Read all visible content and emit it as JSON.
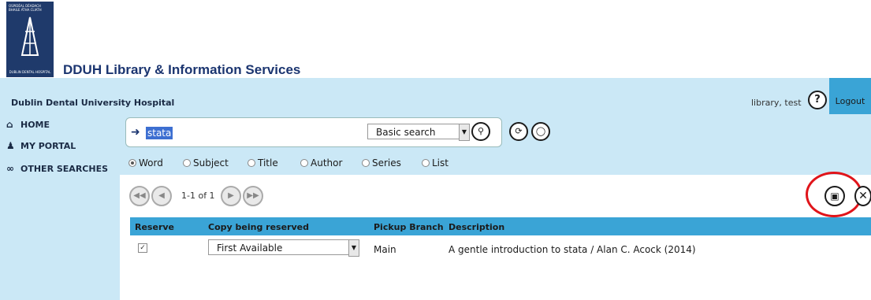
{
  "header": {
    "logo_top": "OSPIDÉAL DÉADACH BHAILE ÁTHA CLIATH",
    "logo_bottom": "DUBLIN DENTAL HOSPITAL",
    "title": "DDUH Library & Information Services"
  },
  "userbar": {
    "org": "Dublin Dental University Hospital",
    "user": "library, test",
    "help": "?",
    "logout": "Logout"
  },
  "sidebar": {
    "items": [
      {
        "label": "HOME",
        "icon": "home-icon"
      },
      {
        "label": "MY PORTAL",
        "icon": "user-icon"
      },
      {
        "label": "OTHER SEARCHES",
        "icon": "binoculars-icon"
      }
    ]
  },
  "search": {
    "query": "stata",
    "type": "Basic search",
    "options": [
      {
        "label": "Word",
        "selected": true
      },
      {
        "label": "Subject",
        "selected": false
      },
      {
        "label": "Title",
        "selected": false
      },
      {
        "label": "Author",
        "selected": false
      },
      {
        "label": "Series",
        "selected": false
      },
      {
        "label": "List",
        "selected": false
      }
    ]
  },
  "pagination": {
    "text": "1-1 of 1"
  },
  "table": {
    "columns": [
      "Reserve",
      "Copy being reserved",
      "Pickup Branch",
      "Description"
    ],
    "rows": [
      {
        "reserve_checked": true,
        "copy": "First Available",
        "branch": "Main",
        "description": "A gentle introduction to stata  /  Alan C. Acock  (2014)"
      }
    ]
  },
  "colors": {
    "bar": "#cbe8f6",
    "accent": "#3aa4d6",
    "title": "#1b3570",
    "highlight": "#e0141a"
  }
}
